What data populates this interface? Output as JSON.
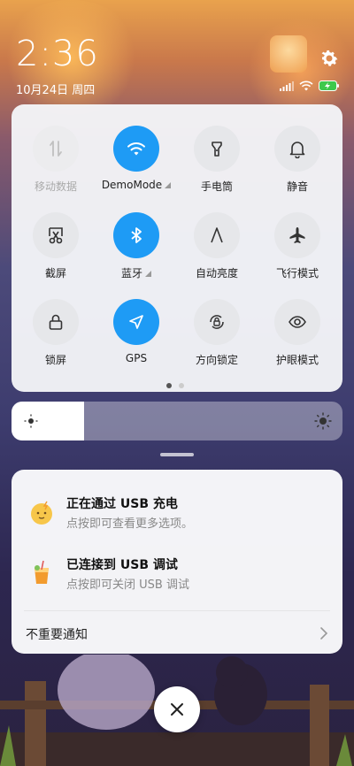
{
  "status": {
    "time": "2:36",
    "date": "10月24日 周四"
  },
  "tiles": [
    {
      "label": "移动数据",
      "icon": "mobile-data-icon",
      "state": "disabled"
    },
    {
      "label": "DemoMode",
      "icon": "wifi-icon",
      "state": "on",
      "has_more": true
    },
    {
      "label": "手电筒",
      "icon": "flashlight-icon",
      "state": "off"
    },
    {
      "label": "静音",
      "icon": "bell-icon",
      "state": "off"
    },
    {
      "label": "截屏",
      "icon": "screenshot-scissors-icon",
      "state": "off"
    },
    {
      "label": "蓝牙",
      "icon": "bluetooth-icon",
      "state": "on",
      "has_more": true
    },
    {
      "label": "自动亮度",
      "icon": "auto-brightness-icon",
      "state": "off"
    },
    {
      "label": "飞行模式",
      "icon": "airplane-icon",
      "state": "off"
    },
    {
      "label": "锁屏",
      "icon": "lock-icon",
      "state": "off"
    },
    {
      "label": "GPS",
      "icon": "location-arrow-icon",
      "state": "on"
    },
    {
      "label": "方向锁定",
      "icon": "rotation-lock-icon",
      "state": "off"
    },
    {
      "label": "护眼模式",
      "icon": "eye-icon",
      "state": "off"
    }
  ],
  "page_indicator": {
    "pages": 2,
    "current": 1
  },
  "brightness": {
    "level": 0.22
  },
  "notifications": [
    {
      "title": "正在通过 USB 充电",
      "subtitle": "点按即可查看更多选项。",
      "icon": "charging-face-icon"
    },
    {
      "title": "已连接到 USB 调试",
      "subtitle": "点按即可关闭 USB 调试",
      "icon": "juice-cup-icon"
    }
  ],
  "unimportant_label": "不重要通知",
  "colors": {
    "accent": "#1e9bf5",
    "panel": "#f4f5f8"
  }
}
